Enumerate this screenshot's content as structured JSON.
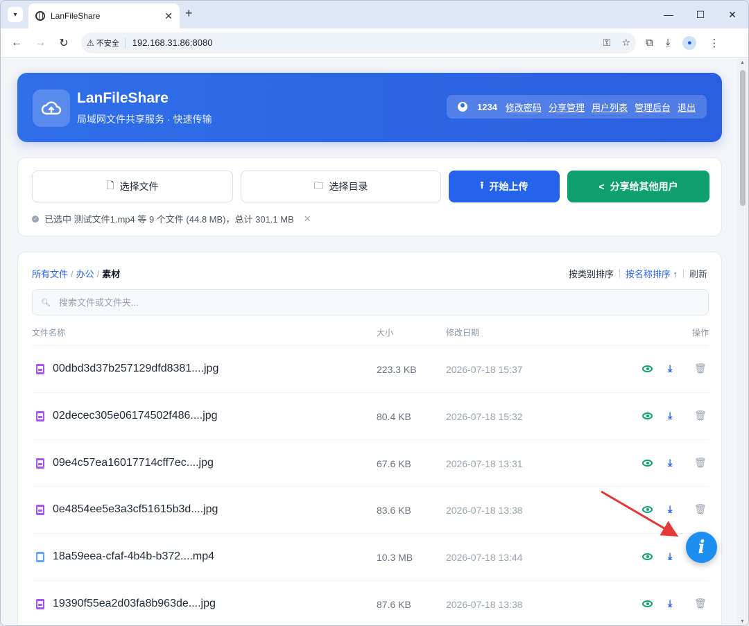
{
  "browser": {
    "tab_title": "LanFileShare",
    "insecure_label": "不安全",
    "url": "192.168.31.86:8080"
  },
  "header": {
    "app_name": "LanFileShare",
    "subtitle": "局域网文件共享服务 · 快速传输",
    "username": "1234",
    "links": [
      "修改密码",
      "分享管理",
      "用户列表",
      "管理后台",
      "退出"
    ]
  },
  "upload": {
    "choose_file": "选择文件",
    "choose_dir": "选择目录",
    "start_upload": "开始上传",
    "share": "分享给其他用户",
    "selection_info": "已选中 测试文件1.mp4 等 9 个文件 (44.8 MB)，总计 301.1 MB"
  },
  "files": {
    "breadcrumb": [
      "所有文件",
      "办公",
      "素材"
    ],
    "sort_by_type": "按类别排序",
    "sort_by_name": "按名称排序 ↑",
    "refresh": "刷新",
    "search_placeholder": "搜索文件或文件夹...",
    "columns": {
      "name": "文件名称",
      "size": "大小",
      "date": "修改日期",
      "actions": "操作"
    },
    "rows": [
      {
        "name": "00dbd3d37b257129dfd8381....jpg",
        "size": "223.3 KB",
        "date": "2026-07-18 15:37",
        "type": "image"
      },
      {
        "name": "02decec305e06174502f486....jpg",
        "size": "80.4 KB",
        "date": "2026-07-18 15:32",
        "type": "image"
      },
      {
        "name": "09e4c57ea16017714cff7ec....jpg",
        "size": "67.6 KB",
        "date": "2026-07-18 13:31",
        "type": "image"
      },
      {
        "name": "0e4854ee5e3a3cf51615b3d....jpg",
        "size": "83.6 KB",
        "date": "2026-07-18 13:38",
        "type": "image"
      },
      {
        "name": "18a59eea-cfaf-4b4b-b372....mp4",
        "size": "10.3 MB",
        "date": "2026-07-18 13:44",
        "type": "video"
      },
      {
        "name": "19390f55ea2d03fa8b963de....jpg",
        "size": "87.6 KB",
        "date": "2026-07-18 13:38",
        "type": "image"
      }
    ]
  },
  "fab_label": "i",
  "colors": {
    "primary": "#2563eb",
    "success": "#0e9f6e",
    "arrow": "#e53935"
  }
}
